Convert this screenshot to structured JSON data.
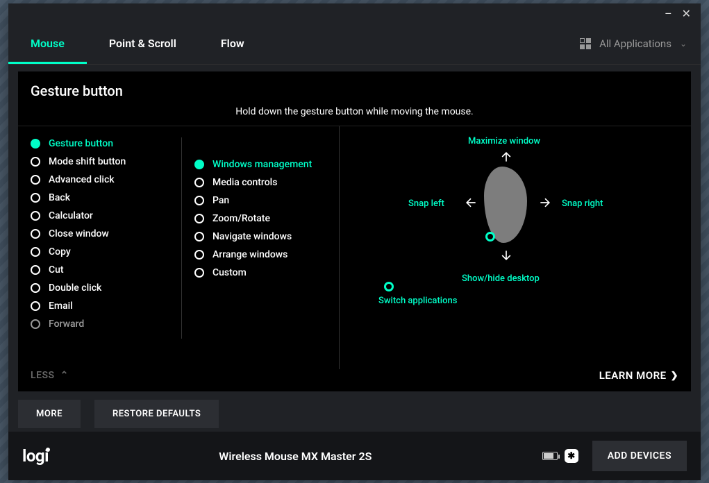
{
  "tabs": {
    "mouse": "Mouse",
    "point": "Point & Scroll",
    "flow": "Flow"
  },
  "apps_label": "All Applications",
  "section": {
    "title": "Gesture button",
    "hint": "Hold down the gesture button while moving the mouse."
  },
  "actions": [
    "Gesture button",
    "Mode shift button",
    "Advanced click",
    "Back",
    "Calculator",
    "Close window",
    "Copy",
    "Cut",
    "Double click",
    "Email",
    "Forward"
  ],
  "gestures": [
    "Windows management",
    "Media controls",
    "Pan",
    "Zoom/Rotate",
    "Navigate windows",
    "Arrange windows",
    "Custom"
  ],
  "diagram": {
    "up": "Maximize window",
    "down": "Show/hide desktop",
    "left": "Snap left",
    "right": "Snap right",
    "switch": "Switch applications"
  },
  "less": "LESS",
  "learn": "LEARN MORE",
  "buttons": {
    "more": "MORE",
    "restore": "RESTORE DEFAULTS"
  },
  "footer": {
    "logo": "logi",
    "device": "Wireless Mouse MX Master 2S",
    "add": "ADD DEVICES"
  }
}
